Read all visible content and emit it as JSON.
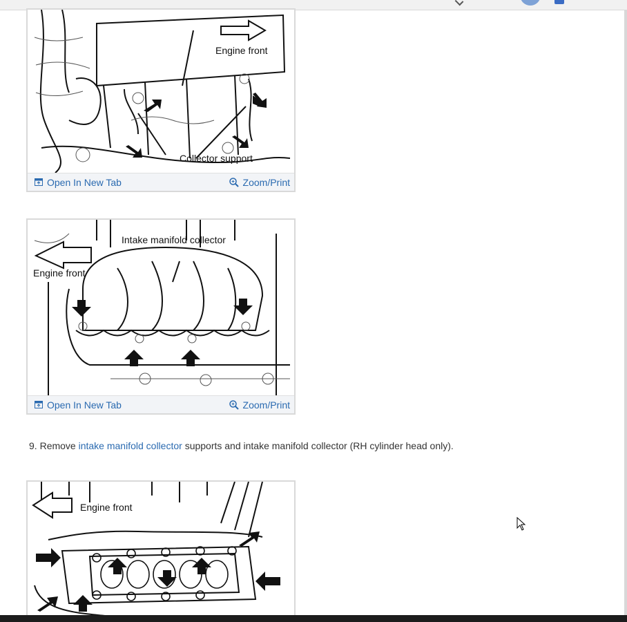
{
  "figures": [
    {
      "labels": [
        "Engine front",
        "Collector support"
      ],
      "open_link": "Open In New Tab",
      "zoom_link": "Zoom/Print"
    },
    {
      "labels": [
        "Intake manifold collector",
        "Engine front"
      ],
      "open_link": "Open In New Tab",
      "zoom_link": "Zoom/Print"
    },
    {
      "labels": [
        "Engine front"
      ]
    }
  ],
  "step": {
    "number": "9.",
    "text_before": "Remove",
    "link": "intake manifold collector",
    "text_after": "supports and intake manifold collector (RH cylinder head only)."
  }
}
